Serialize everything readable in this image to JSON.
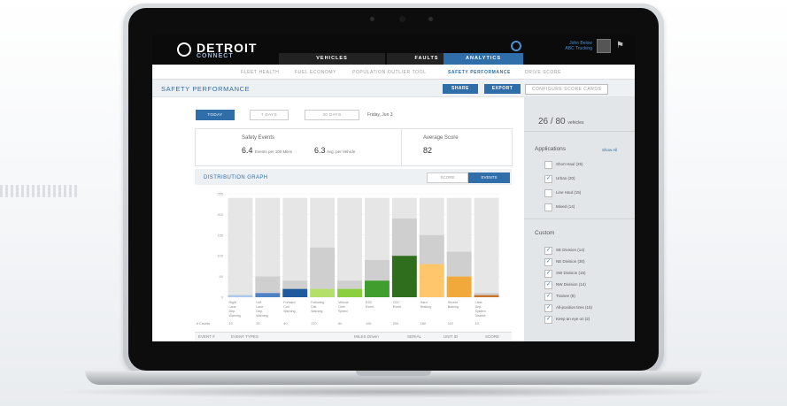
{
  "app": {
    "brand": "DETROIT",
    "brand_sub": "CONNECT",
    "user_name": "John Below",
    "user_company": "ABC Trucking"
  },
  "main_tabs": [
    {
      "label": "VEHICLES",
      "active": false
    },
    {
      "label": "FAULTS",
      "active": false
    },
    {
      "label": "ANALYTICS",
      "active": true
    }
  ],
  "sub_nav": [
    {
      "label": "FLEET HEALTH",
      "active": false
    },
    {
      "label": "FUEL ECONOMY",
      "active": false
    },
    {
      "label": "POPULATION OUTLIER TOOL",
      "active": false
    },
    {
      "label": "SAFETY PERFORMANCE",
      "active": true
    },
    {
      "label": "DRIVE SCORE",
      "active": false
    }
  ],
  "page": {
    "title": "SAFETY PERFORMANCE",
    "share_label": "SHARE",
    "export_label": "EXPORT",
    "configure_label": "CONFIGURE SCORE CARDS"
  },
  "range": {
    "options": [
      "TODAY",
      "7 DAYS",
      "30 DAYS"
    ],
    "active": "TODAY",
    "date": "Friday, Jun 3"
  },
  "summary": {
    "events_title": "Safety Events",
    "events_per_value": "6.4",
    "events_per_label": "Events per 100 Miles",
    "avg_vehicle_value": "6.3",
    "avg_vehicle_label": "Avg. per Vehicle",
    "avg_score_title": "Average Score",
    "avg_score_value": "82"
  },
  "graph": {
    "title": "DISTRIBUTION GRAPH",
    "toggle_score": "SCORE",
    "toggle_events": "EVENTS",
    "count_label": "# Counts"
  },
  "chart_data": {
    "type": "bar",
    "categories": [
      "Right Lane Dep. Warning",
      "Left Lane Dep. Warning",
      "Forward Coll. Warning",
      "Following Dist. Warning",
      "Vehicle Over Speed",
      "ESC Event",
      "CDC Event",
      "Hard Braking",
      "Severe Braking",
      "Lane Dep. System Disable"
    ],
    "counts": [
      "10",
      "20",
      "40",
      "170",
      "60",
      "100",
      "200",
      "160",
      "110",
      "10"
    ],
    "series": [
      {
        "values": [
          5,
          10,
          20,
          20,
          20,
          40,
          100,
          80,
          50,
          5
        ],
        "colors": [
          "#a9c8ea",
          "#4b82c4",
          "#1f5a9e",
          "#b4e06a",
          "#8ccf3e",
          "#3f9e2e",
          "#2f6e1c",
          "#ffc66b",
          "#f2a93b",
          "#c8742d"
        ]
      },
      {
        "values": [
          0,
          40,
          20,
          100,
          20,
          50,
          90,
          70,
          60,
          5
        ]
      },
      {
        "values": [
          240,
          240,
          240,
          240,
          240,
          240,
          240,
          240,
          240,
          240
        ]
      }
    ],
    "yticks": [
      "250",
      "200",
      "150",
      "100",
      "50",
      "0"
    ],
    "ylim": [
      0,
      250
    ]
  },
  "table_headers": [
    "EVENT #",
    "EVENT TYPES",
    "MILES Driven",
    "SERIAL",
    "UNIT ID",
    "SCORE"
  ],
  "sidebar": {
    "vehicle_count": "26 / 80",
    "vehicle_suffix": "vehicles",
    "applications_title": "Applications",
    "show_all": "Show All",
    "applications": [
      {
        "label": "Short Haul (25)",
        "checked": false
      },
      {
        "label": "Urban (20)",
        "checked": true
      },
      {
        "label": "Line Haul (15)",
        "checked": false
      },
      {
        "label": "Mixed (14)",
        "checked": false
      }
    ],
    "custom_title": "Custom",
    "custom": [
      {
        "label": "SE Division (14)",
        "checked": true
      },
      {
        "label": "NE Division (30)",
        "checked": true
      },
      {
        "label": "SW Division (15)",
        "checked": true
      },
      {
        "label": "NW Division (14)",
        "checked": true
      },
      {
        "label": "Trainee (8)",
        "checked": true
      },
      {
        "label": "All-position tires (15)",
        "checked": true
      },
      {
        "label": "Keep an eye on (2)",
        "checked": true
      }
    ]
  },
  "decor": {
    "stripes": "||||||||||||||||"
  }
}
